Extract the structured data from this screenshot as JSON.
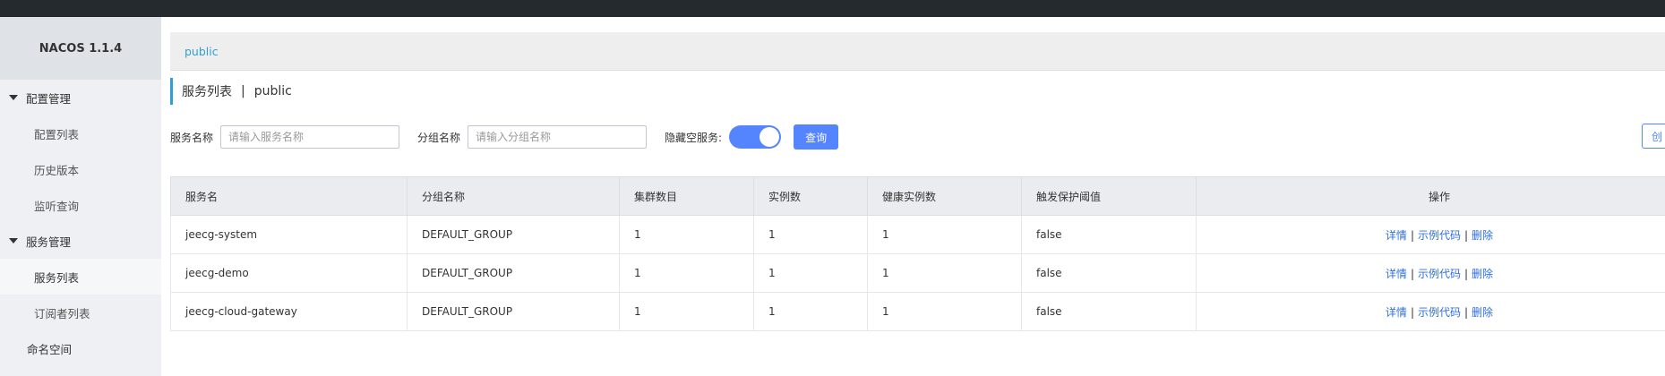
{
  "app": {
    "name": "NACOS 1.1.4"
  },
  "sidebar": {
    "groups": [
      {
        "label": "配置管理",
        "items": [
          "配置列表",
          "历史版本",
          "监听查询"
        ]
      },
      {
        "label": "服务管理",
        "items": [
          "服务列表",
          "订阅者列表"
        ]
      }
    ],
    "namespace": "命名空间",
    "active_item": "服务列表"
  },
  "breadcrumb": {
    "namespace": "public"
  },
  "page": {
    "title": "服务列表",
    "separator": "|",
    "namespace": "public"
  },
  "filters": {
    "service_name_label": "服务名称",
    "service_name_placeholder": "请输入服务名称",
    "group_name_label": "分组名称",
    "group_name_placeholder": "请输入分组名称",
    "hide_empty_label": "隐藏空服务:",
    "hide_empty_on": true,
    "query_label": "查询",
    "create_label": "创"
  },
  "colors": {
    "accent": "#5584ff",
    "link": "#2e6fde",
    "crumb": "#2da0d8",
    "topbar": "#252a2f"
  },
  "table": {
    "columns": [
      "服务名",
      "分组名称",
      "集群数目",
      "实例数",
      "健康实例数",
      "触发保护阈值",
      "操作"
    ],
    "rows": [
      [
        "jeecg-system",
        "DEFAULT_GROUP",
        "1",
        "1",
        "1",
        "false"
      ],
      [
        "jeecg-demo",
        "DEFAULT_GROUP",
        "1",
        "1",
        "1",
        "false"
      ],
      [
        "jeecg-cloud-gateway",
        "DEFAULT_GROUP",
        "1",
        "1",
        "1",
        "false"
      ]
    ],
    "actions": {
      "detail": "详情",
      "sample": "示例代码",
      "delete": "删除",
      "sep": "|"
    }
  }
}
